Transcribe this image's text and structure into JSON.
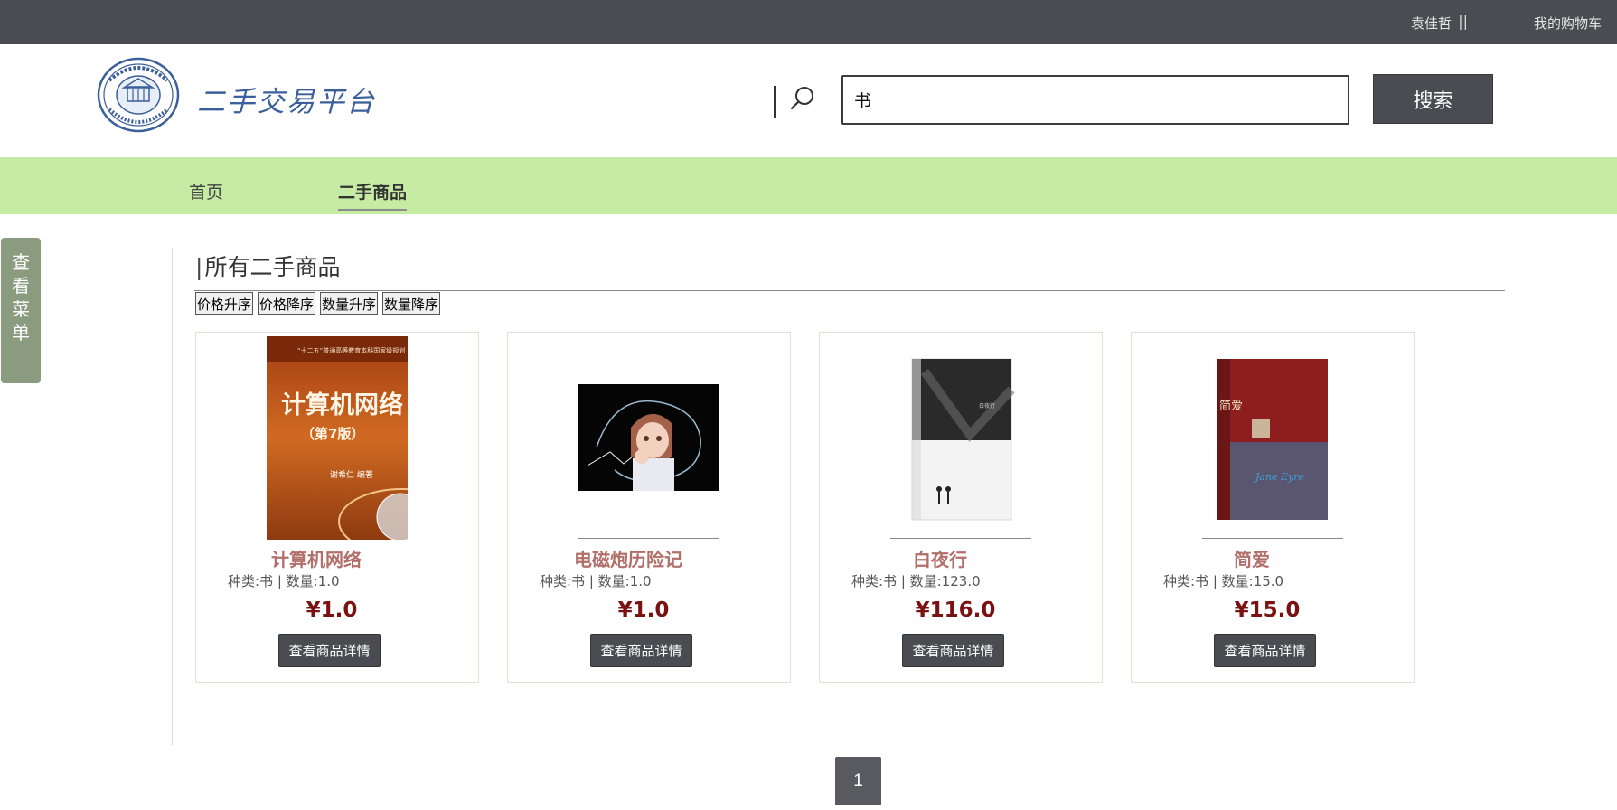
{
  "topbar": {
    "user_name": "袁佳哲",
    "separator": "||",
    "cart_label": "我的购物车"
  },
  "header": {
    "site_title": "二手交易平台",
    "seal_text_top": "厦大门",
    "seal_text_bottom": "UNIVERSITAS AMOIENSIS",
    "search_value": "书",
    "search_button": "搜索"
  },
  "nav": {
    "home": "首页",
    "used_goods": "二手商品"
  },
  "side_menu": {
    "chars": [
      "查",
      "看",
      "菜",
      "单"
    ]
  },
  "section": {
    "bar": "|",
    "title": "所有二手商品"
  },
  "sort_buttons": [
    "价格升序",
    "价格降序",
    "数量升序",
    "数量降序"
  ],
  "products": [
    {
      "name": "计算机网络",
      "meta": "种类:书 | 数量:1.0",
      "price": "¥1.0",
      "button": "查看商品详情",
      "cover": {
        "top_text": "“十二五”普通高等教育本科国家级规划",
        "title": "计算机网络",
        "edition": "（第7版）",
        "author": "谢希仁 编著"
      }
    },
    {
      "name": "电磁炮历险记",
      "meta": "种类:书 | 数量:1.0",
      "price": "¥1.0",
      "button": "查看商品详情"
    },
    {
      "name": "白夜行",
      "meta": "种类:书 | 数量:123.0",
      "price": "¥116.0",
      "button": "查看商品详情"
    },
    {
      "name": "简爱",
      "meta": "种类:书 | 数量:15.0",
      "price": "¥15.0",
      "button": "查看商品详情",
      "cover": {
        "spine_text": "简爱",
        "script_text": "Jane Eyre"
      }
    }
  ],
  "pagination": {
    "current": "1"
  },
  "colors": {
    "topbar": "#4b4c51",
    "nav_bg": "#c6eba4",
    "product_name": "#b26f6a",
    "price": "#7a1212",
    "side_menu": "#8a9b80"
  }
}
